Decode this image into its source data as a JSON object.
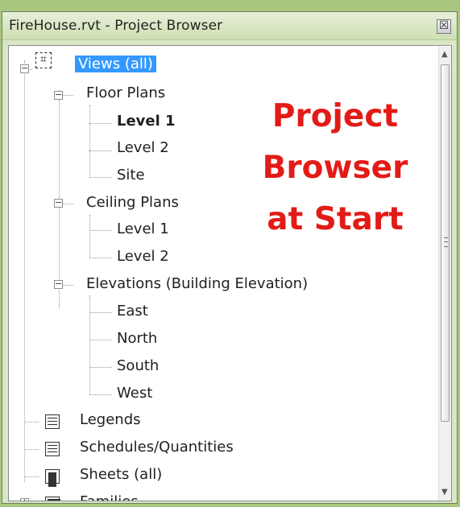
{
  "window": {
    "title": "FireHouse.rvt - Project Browser",
    "close_glyph": "☒"
  },
  "tree": {
    "views_label": "Views (all)",
    "floor_plans": {
      "label": "Floor Plans",
      "items": [
        "Level 1",
        "Level 2",
        "Site"
      ]
    },
    "ceiling_plans": {
      "label": "Ceiling Plans",
      "items": [
        "Level 1",
        "Level 2"
      ]
    },
    "elevations": {
      "label": "Elevations (Building Elevation)",
      "items": [
        "East",
        "North",
        "South",
        "West"
      ]
    },
    "legends": "Legends",
    "schedules": "Schedules/Quantities",
    "sheets": "Sheets (all)",
    "families": "Families"
  },
  "overlay": {
    "line1": "Project",
    "line2": "Browser",
    "line3": "at Start"
  },
  "scroll": {
    "up": "▲",
    "down": "▼"
  }
}
